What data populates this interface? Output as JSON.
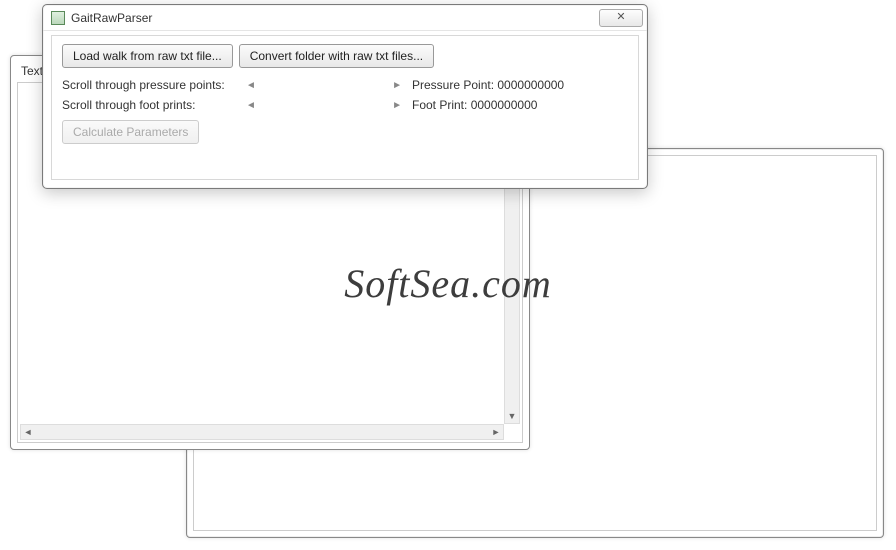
{
  "back_window": {},
  "text_window": {
    "title": "Text"
  },
  "dialog": {
    "title": "GaitRawParser",
    "close_glyph": "✕",
    "buttons": {
      "load": "Load walk from raw txt file...",
      "convert": "Convert folder with raw txt files...",
      "calc": "Calculate Parameters"
    },
    "pressure": {
      "label": "Scroll through pressure points:",
      "left_glyph": "◄",
      "right_glyph": "►",
      "value_label": "Pressure Point: 0000000000"
    },
    "foot": {
      "label": "Scroll through foot prints:",
      "left_glyph": "◄",
      "right_glyph": "►",
      "value_label": "Foot Print: 0000000000"
    }
  },
  "watermark": "SoftSea.com"
}
